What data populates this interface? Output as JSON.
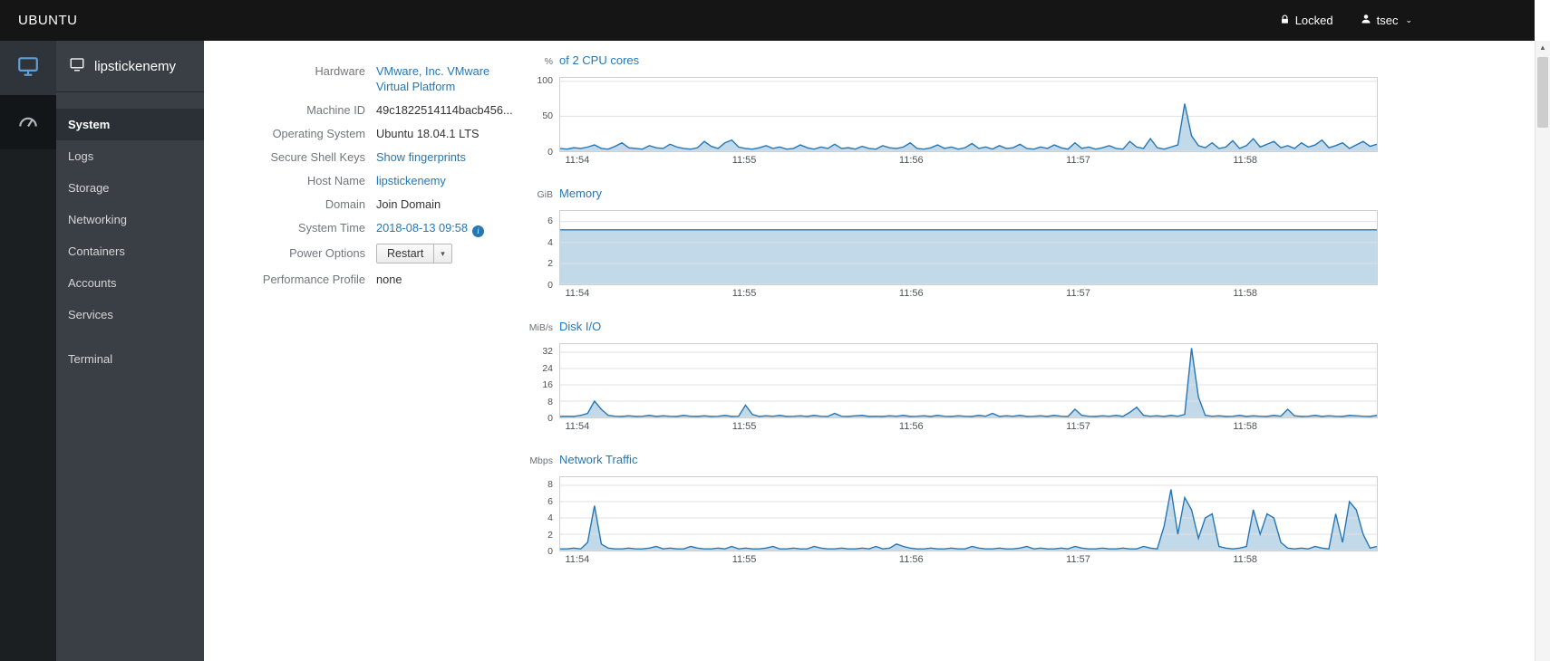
{
  "colors": {
    "link": "#2577b5",
    "chart-line": "#2577b5",
    "chart-fill": "rgba(37,119,181,0.28)",
    "brand-bar": "#151515",
    "sidebar": "#393f44",
    "sidebar-active": "#2b3036",
    "strip": "#1c1f22"
  },
  "topbar": {
    "brand": "UBUNTU",
    "locked": "Locked",
    "user": "tsec"
  },
  "sidebar": {
    "host": "lipstickenemy",
    "items": [
      {
        "label": "System",
        "active": true
      },
      {
        "label": "Logs"
      },
      {
        "label": "Storage"
      },
      {
        "label": "Networking"
      },
      {
        "label": "Containers"
      },
      {
        "label": "Accounts"
      },
      {
        "label": "Services"
      },
      {
        "label": "Terminal",
        "separated": true
      }
    ]
  },
  "system": {
    "rows": [
      {
        "label": "Hardware",
        "value": "VMware, Inc. VMware Virtual Platform",
        "type": "link",
        "wrap": true
      },
      {
        "label": "Machine ID",
        "value": "49c1822514114bacb456...",
        "type": "text"
      },
      {
        "label": "Operating System",
        "value": "Ubuntu 18.04.1 LTS",
        "type": "text"
      },
      {
        "label": "Secure Shell Keys",
        "value": "Show fingerprints",
        "type": "link"
      },
      {
        "label": "Host Name",
        "value": "lipstickenemy",
        "type": "link"
      },
      {
        "label": "Domain",
        "value": "Join Domain",
        "type": "action"
      },
      {
        "label": "System Time",
        "value": "2018-08-13 09:58",
        "type": "link",
        "info_icon": true
      },
      {
        "label": "Power Options",
        "value": "Restart",
        "type": "button"
      },
      {
        "label": "Performance Profile",
        "value": "none",
        "type": "text"
      }
    ]
  },
  "chart_data": [
    {
      "id": "cpu",
      "type": "area",
      "unit": "%",
      "title": "of 2 CPU cores",
      "ymax": 105,
      "yticks": [
        0,
        50,
        100
      ],
      "xticks": [
        {
          "label": "11:54",
          "frac": 0.022
        },
        {
          "label": "11:55",
          "frac": 0.226
        },
        {
          "label": "11:56",
          "frac": 0.43
        },
        {
          "label": "11:57",
          "frac": 0.634
        },
        {
          "label": "11:58",
          "frac": 0.838
        }
      ],
      "values": [
        4,
        3,
        5,
        4,
        6,
        9,
        4,
        3,
        7,
        12,
        5,
        4,
        3,
        8,
        5,
        4,
        10,
        6,
        4,
        3,
        5,
        14,
        7,
        4,
        12,
        16,
        6,
        4,
        3,
        5,
        8,
        4,
        6,
        3,
        4,
        9,
        5,
        3,
        6,
        4,
        10,
        4,
        5,
        3,
        7,
        4,
        3,
        8,
        5,
        4,
        6,
        12,
        4,
        3,
        5,
        9,
        4,
        6,
        3,
        5,
        11,
        4,
        6,
        3,
        8,
        4,
        5,
        10,
        4,
        3,
        6,
        4,
        9,
        5,
        3,
        12,
        4,
        6,
        3,
        5,
        8,
        4,
        3,
        14,
        6,
        4,
        18,
        5,
        3,
        6,
        9,
        68,
        22,
        8,
        5,
        12,
        4,
        6,
        15,
        4,
        8,
        18,
        6,
        10,
        14,
        5,
        8,
        4,
        12,
        6,
        9,
        16,
        5,
        8,
        12,
        4,
        9,
        14,
        7,
        10
      ]
    },
    {
      "id": "memory",
      "type": "area",
      "unit": "GiB",
      "title": "Memory",
      "ymax": 7,
      "yticks": [
        0,
        2,
        4,
        6
      ],
      "xticks": [
        {
          "label": "11:54",
          "frac": 0.022
        },
        {
          "label": "11:55",
          "frac": 0.226
        },
        {
          "label": "11:56",
          "frac": 0.43
        },
        {
          "label": "11:57",
          "frac": 0.634
        },
        {
          "label": "11:58",
          "frac": 0.838
        }
      ],
      "values": [
        5.2,
        5.2,
        5.2,
        5.2,
        5.2,
        5.2,
        5.2,
        5.2,
        5.2,
        5.2,
        5.2
      ]
    },
    {
      "id": "disk-io",
      "type": "area",
      "unit": "MiB/s",
      "title": "Disk I/O",
      "ymax": 36,
      "yticks": [
        0,
        8,
        16,
        24,
        32
      ],
      "xticks": [
        {
          "label": "11:54",
          "frac": 0.022
        },
        {
          "label": "11:55",
          "frac": 0.226
        },
        {
          "label": "11:56",
          "frac": 0.43
        },
        {
          "label": "11:57",
          "frac": 0.634
        },
        {
          "label": "11:58",
          "frac": 0.838
        }
      ],
      "values": [
        0.5,
        0.6,
        0.5,
        1,
        2,
        8,
        4,
        1,
        0.6,
        0.5,
        0.8,
        0.5,
        0.6,
        1,
        0.5,
        0.8,
        0.6,
        0.5,
        1,
        0.6,
        0.5,
        0.8,
        0.5,
        0.6,
        1,
        0.5,
        0.6,
        6,
        1.5,
        0.5,
        0.8,
        0.6,
        1,
        0.5,
        0.6,
        0.8,
        0.5,
        1,
        0.6,
        0.5,
        2,
        0.6,
        0.5,
        0.8,
        1,
        0.5,
        0.6,
        0.5,
        0.8,
        0.6,
        1,
        0.5,
        0.6,
        0.8,
        0.5,
        1,
        0.6,
        0.5,
        0.8,
        0.6,
        0.5,
        1,
        0.6,
        2,
        0.5,
        0.8,
        0.6,
        1,
        0.5,
        0.6,
        0.8,
        0.5,
        1,
        0.6,
        0.5,
        4,
        1,
        0.6,
        0.5,
        0.8,
        0.6,
        1,
        0.5,
        2.5,
        5,
        1,
        0.6,
        0.8,
        0.5,
        1,
        0.6,
        1.5,
        34,
        10,
        1,
        0.6,
        0.8,
        0.5,
        0.6,
        1,
        0.5,
        0.8,
        0.6,
        0.5,
        1,
        0.6,
        4,
        0.8,
        0.5,
        0.6,
        1,
        0.5,
        0.8,
        0.6,
        0.5,
        1,
        0.8,
        0.6,
        0.5,
        1
      ]
    },
    {
      "id": "network",
      "type": "area",
      "unit": "Mbps",
      "title": "Network Traffic",
      "ymax": 9,
      "yticks": [
        0,
        2,
        4,
        6,
        8
      ],
      "xticks": [
        {
          "label": "11:54",
          "frac": 0.022
        },
        {
          "label": "11:55",
          "frac": 0.226
        },
        {
          "label": "11:56",
          "frac": 0.43
        },
        {
          "label": "11:57",
          "frac": 0.634
        },
        {
          "label": "11:58",
          "frac": 0.838
        }
      ],
      "values": [
        0.2,
        0.2,
        0.3,
        0.2,
        1,
        5.5,
        0.8,
        0.3,
        0.2,
        0.2,
        0.3,
        0.2,
        0.2,
        0.3,
        0.5,
        0.2,
        0.3,
        0.2,
        0.2,
        0.5,
        0.3,
        0.2,
        0.2,
        0.3,
        0.2,
        0.5,
        0.2,
        0.3,
        0.2,
        0.2,
        0.3,
        0.5,
        0.2,
        0.2,
        0.3,
        0.2,
        0.2,
        0.5,
        0.3,
        0.2,
        0.2,
        0.3,
        0.2,
        0.2,
        0.3,
        0.2,
        0.5,
        0.2,
        0.3,
        0.8,
        0.5,
        0.3,
        0.2,
        0.2,
        0.3,
        0.2,
        0.2,
        0.3,
        0.2,
        0.2,
        0.5,
        0.3,
        0.2,
        0.2,
        0.3,
        0.2,
        0.2,
        0.3,
        0.5,
        0.2,
        0.3,
        0.2,
        0.2,
        0.3,
        0.2,
        0.5,
        0.3,
        0.2,
        0.2,
        0.3,
        0.2,
        0.2,
        0.3,
        0.2,
        0.2,
        0.5,
        0.3,
        0.2,
        3,
        7.5,
        2,
        6.5,
        5,
        1.5,
        4,
        4.5,
        0.5,
        0.3,
        0.2,
        0.3,
        0.5,
        5,
        2,
        4.5,
        4,
        1,
        0.3,
        0.2,
        0.3,
        0.2,
        0.5,
        0.3,
        0.2,
        4.5,
        1,
        6,
        5,
        2,
        0.3,
        0.5
      ]
    }
  ]
}
